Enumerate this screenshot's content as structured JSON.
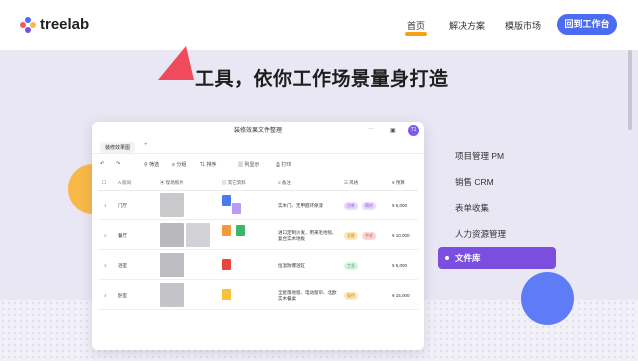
{
  "header": {
    "logo_text": "treelab",
    "nav": [
      "首页",
      "解决方案",
      "模版市场"
    ],
    "cta_label": "回到工作台"
  },
  "hero": {
    "headline": "工具，依你工作场景量身打造"
  },
  "app": {
    "title": "装修效果文件整理",
    "more": "···",
    "book_icon_text": "▣",
    "avatar": "T1",
    "tab": "装修效果图",
    "tab_add": "+",
    "toolbar": {
      "undo": "↶",
      "redo": "↷",
      "filter": "筛选",
      "group": "分组",
      "sort": "排序",
      "columns": "列显示",
      "print": "打印"
    },
    "columns": [
      "房间",
      "现场照片",
      "其它资料",
      "备注",
      "风格",
      "预算"
    ],
    "rows": [
      {
        "num": "1",
        "room": "门厅",
        "note": "实木门、无甲醛环保漆",
        "tags": [
          "古朴",
          "简约"
        ],
        "budget": "¥ 5,000"
      },
      {
        "num": "2",
        "room": "餐厅",
        "note": "进口定制沙发，用来毛地毯、复合实木地板",
        "tags": [
          "北欧",
          "中式"
        ],
        "budget": "¥ 10,000"
      },
      {
        "num": "3",
        "room": "浴室",
        "note": "恒温防爆浴缸",
        "tags": [
          "工业"
        ],
        "budget": "¥ 5,000"
      },
      {
        "num": "4",
        "room": "卧室",
        "note": "全屋落地窗、电动窗帘、北欧实木餐桌",
        "tags": [
          "现代"
        ],
        "budget": "¥ 15,000"
      }
    ]
  },
  "menu": {
    "items": [
      "项目管理 PM",
      "销售 CRM",
      "表单收集",
      "人力资源管理"
    ],
    "active": "文件库"
  },
  "colors": {
    "accent_blue": "#4b6bf0",
    "accent_purple": "#7b4ee0",
    "orange": "#f9b948",
    "triangle_red": "#ef4b5c"
  }
}
